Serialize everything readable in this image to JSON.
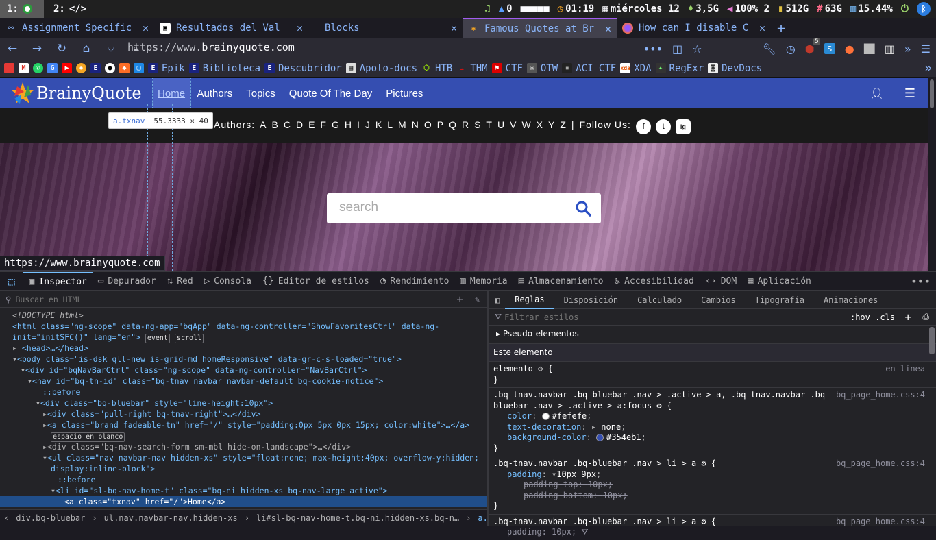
{
  "system_bar": {
    "ws1": "1:",
    "ws2": "2:",
    "ws2_icon": "</>",
    "items": [
      "0",
      "■■■■■",
      "01:19",
      "miércoles 12",
      "3,5G",
      "100% 2",
      "512G",
      "63G",
      "15.44%"
    ]
  },
  "tabs": [
    {
      "title": "Assignment Specific",
      "active": false
    },
    {
      "title": "Resultados del Val",
      "active": false
    },
    {
      "title": "Blocks",
      "active": false
    },
    {
      "title": "Famous Quotes at Br",
      "active": true
    },
    {
      "title": "How can I disable C",
      "active": false
    }
  ],
  "nav": {
    "url_prefix": "https://www.",
    "url_domain": "brainyquote.com",
    "ublock_count": "5"
  },
  "bookmarks": [
    "Epik",
    "Biblioteca",
    "Descubridor",
    "Apolo-docs",
    "HTB",
    "THM",
    "CTF",
    "OTW",
    "ACI CTF",
    "XDA",
    "RegExr",
    "DevDocs"
  ],
  "page": {
    "logo": "BrainyQuote",
    "top_nav": [
      "Home",
      "Authors",
      "Topics",
      "Quote Of The Day",
      "Pictures"
    ],
    "authors_label": "Authors:",
    "letters": [
      "A",
      "B",
      "C",
      "D",
      "E",
      "F",
      "G",
      "H",
      "I",
      "J",
      "K",
      "L",
      "M",
      "N",
      "O",
      "P",
      "Q",
      "R",
      "S",
      "T",
      "U",
      "V",
      "W",
      "X",
      "Y",
      "Z"
    ],
    "separator": "|",
    "follow_label": "Follow Us:",
    "social": [
      "f",
      "t",
      "ig"
    ],
    "search_placeholder": "search",
    "tooltip_tag": "a.txnav",
    "tooltip_dims": "55.3333 × 40",
    "status_url": "https://www.brainyquote.com"
  },
  "devtools": {
    "tabs": [
      "Inspector",
      "Depurador",
      "Red",
      "Consola",
      "Editor de estilos",
      "Rendimiento",
      "Memoria",
      "Almacenamiento",
      "Accesibilidad",
      "DOM",
      "Aplicación"
    ],
    "html_search_placeholder": "Buscar en HTML",
    "html_lines": [
      {
        "text": "<!DOCTYPE html>",
        "indent": 0
      },
      {
        "text": "<html class=\"ng-scope\" data-ng-app=\"bqApp\" data-ng-controller=\"ShowFavoritesCtrl\" data-ng-",
        "indent": 0
      },
      {
        "text": "init=\"initSFC()\" lang=\"en\">",
        "indent": 0
      },
      {
        "text": "<head>…</head>",
        "indent": 1
      },
      {
        "text": "<body class=\"is-dsk qll-new is-grid-md homeResponsive\" data-gr-c-s-loaded=\"true\">",
        "indent": 1
      },
      {
        "text": "<div id=\"bqNavBarCtrl\" class=\"ng-scope\" data-ng-controller=\"NavBarCtrl\">",
        "indent": 2
      },
      {
        "text": "<nav id=\"bq-tn-id\" class=\"bq-tnav navbar navbar-default bq-cookie-notice\">",
        "indent": 3
      },
      {
        "text": "::before",
        "indent": 4
      },
      {
        "text": "<div class=\"bq-bluebar\" style=\"line-height:10px\">",
        "indent": 4
      },
      {
        "text": "<div class=\"pull-right bq-tnav-right\">…</div>",
        "indent": 5
      },
      {
        "text": "<a class=\"brand fadeable-tn\" href=\"/\" style=\"padding:0px 5px 0px 15px; color:white\">…</a>",
        "indent": 5
      },
      {
        "text": "espacio en blanco",
        "indent": 5
      },
      {
        "text": "<div class=\"bq-nav-search-form sm-mbl hide-on-landscape\">…</div>",
        "indent": 5
      },
      {
        "text": "<ul class=\"nav navbar-nav hidden-xs\" style=\"float:none; max-height:40px; overflow-y:hidden;",
        "indent": 5
      },
      {
        "text": "display:inline-block\">",
        "indent": 5
      },
      {
        "text": "::before",
        "indent": 6
      },
      {
        "text": "<li id=\"sl-bq-nav-home-t\" class=\"bq-ni hidden-xs bq-nav-large active\">",
        "indent": 6
      },
      {
        "text": "<a class=\"txnav\" href=\"/\">Home</a>",
        "indent": 7
      }
    ],
    "badges": {
      "event": "event",
      "scroll": "scroll"
    },
    "breadcrumb": [
      "div.bq-bluebar",
      "ul.nav.navbar-nav.hidden-xs",
      "li#sl-bq-nav-home-t.bq-ni.hidden-xs.bq-n…",
      "a.txnav"
    ],
    "rule_tabs": [
      "Reglas",
      "Disposición",
      "Calculado",
      "Cambios",
      "Tipografía",
      "Animaciones"
    ],
    "filter_placeholder": "Filtrar estilos",
    "hov_cls": ":hov .cls",
    "pseudo": "Pseudo-elementos",
    "this_element": "Este elemento",
    "element_rule": "elemento",
    "inline": "en línea",
    "rule1_selector": ".bq-tnav.navbar .bq-bluebar .nav > .active > a, .bq-tnav.navbar .bq-bluebar .nav > .active > a:focus",
    "rule1_source": "bq_page_home.css:4",
    "rule1_props": [
      {
        "name": "color",
        "value": "#fefefe",
        "swatch": "#fefefe"
      },
      {
        "name": "text-decoration",
        "value": "none"
      },
      {
        "name": "background-color",
        "value": "#354eb1",
        "swatch": "#354eb1"
      }
    ],
    "rule2_selector": ".bq-tnav.navbar .bq-bluebar .nav > li > a",
    "rule2_source": "bq_page_home.css:4",
    "rule2_props": [
      {
        "name": "padding",
        "value": "10px 9px",
        "struck": false
      },
      {
        "name": "padding-top",
        "value": "10px",
        "struck": true
      },
      {
        "name": "padding-bottom",
        "value": "10px",
        "struck": true
      }
    ],
    "rule3_selector": ".bq-tnav.navbar .bq-bluebar .nav > li > a",
    "rule3_source": "bq_page_home.css:4",
    "rule3_partial": "padding: 10px;"
  }
}
